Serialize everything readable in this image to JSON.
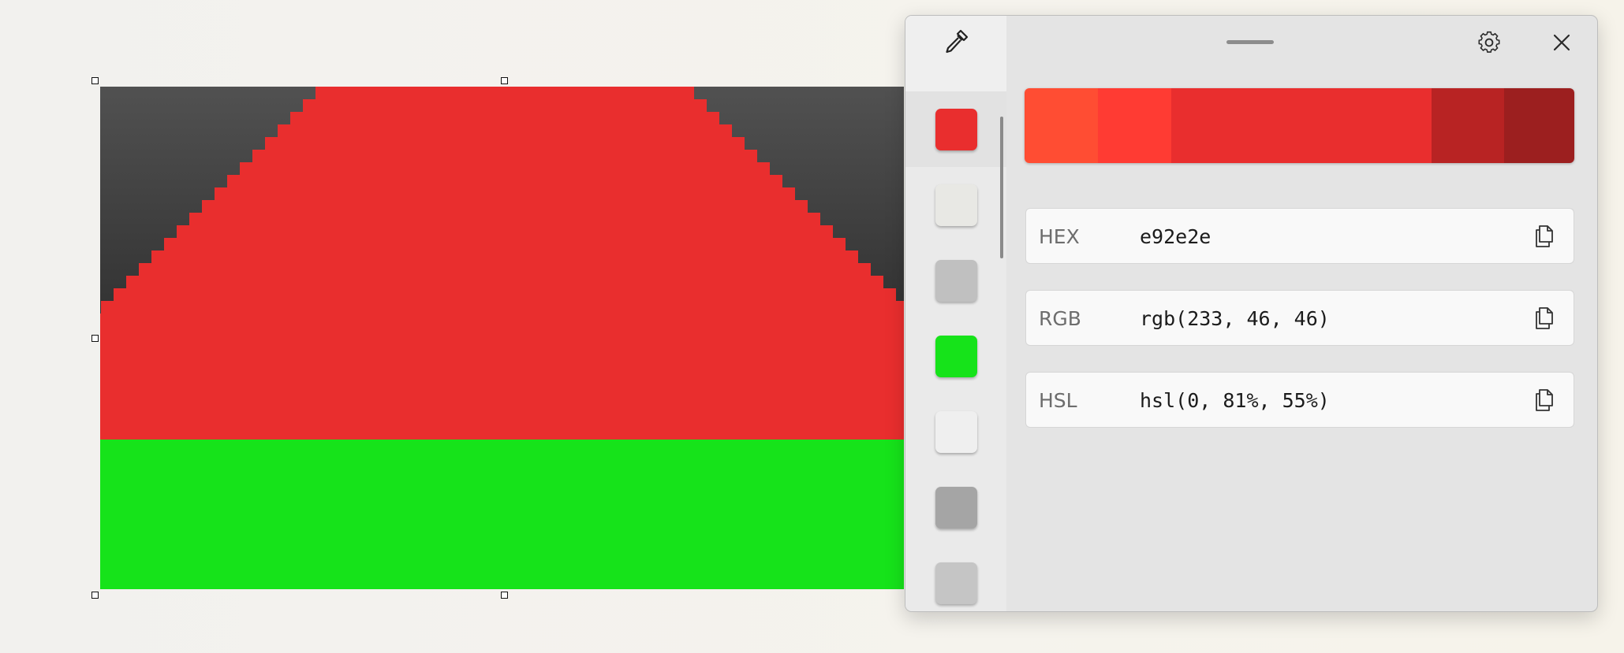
{
  "image": {
    "colors": {
      "background_dark_top": "#515151",
      "background_dark_bottom": "#222222",
      "red": "#e92e2e",
      "green": "#16e31a"
    }
  },
  "color_picker": {
    "icons": {
      "eyedropper": "eyedropper-icon",
      "grip": "drag-handle",
      "settings": "gear-icon",
      "close": "close-icon",
      "copy": "copy-icon"
    },
    "history": [
      {
        "color": "#e92e2e",
        "selected": true
      },
      {
        "color": "#e8e8e4",
        "selected": false
      },
      {
        "color": "#c0c0c0",
        "selected": false
      },
      {
        "color": "#16e31a",
        "selected": false
      },
      {
        "color": "#efefef",
        "selected": false
      },
      {
        "color": "#a5a5a5",
        "selected": false
      },
      {
        "color": "#c5c5c5",
        "selected": false
      }
    ],
    "shades": [
      {
        "color": "#ff4d33"
      },
      {
        "color": "#ff3b33"
      },
      {
        "color": "#e92e2e",
        "current": true
      },
      {
        "color": "#b82323"
      },
      {
        "color": "#9c1f1f"
      }
    ],
    "formats": [
      {
        "label": "HEX",
        "value": "e92e2e"
      },
      {
        "label": "RGB",
        "value": "rgb(233, 46, 46)"
      },
      {
        "label": "HSL",
        "value": "hsl(0, 81%, 55%)"
      }
    ]
  }
}
